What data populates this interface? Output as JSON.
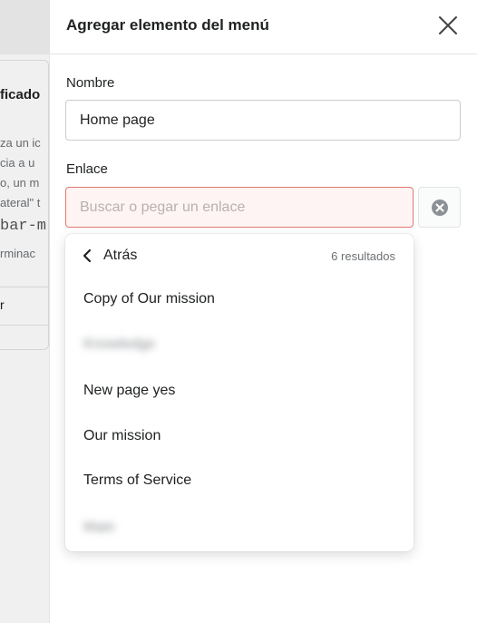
{
  "background": {
    "title_fragment": "ficado",
    "lines": [
      "za un ic",
      "cia a u",
      "o, un m",
      "ateral\" t"
    ],
    "code_fragment": "bar-m",
    "line_after_code": "rminac",
    "item_fragment": "r"
  },
  "panel": {
    "title": "Agregar elemento del menú",
    "name_label": "Nombre",
    "name_value": "Home page",
    "link_label": "Enlace",
    "link_placeholder": "Buscar o pegar un enlace"
  },
  "dropdown": {
    "back_label": "Atrás",
    "result_count": "6 resultados",
    "items": [
      {
        "label": "Copy of Our mission",
        "blurred": false
      },
      {
        "label": "Knowledge",
        "blurred": true
      },
      {
        "label": "New page yes",
        "blurred": false
      },
      {
        "label": "Our mission",
        "blurred": false
      },
      {
        "label": "Terms of Service",
        "blurred": false
      },
      {
        "label": "Main",
        "blurred": true
      }
    ]
  },
  "icons": {
    "close": "close-icon",
    "clear": "circle-x-icon",
    "back": "chevron-left-icon"
  },
  "colors": {
    "error_border": "#e0786f",
    "error_fill": "#fff4f4",
    "text": "#202223",
    "muted": "#6d7175"
  }
}
